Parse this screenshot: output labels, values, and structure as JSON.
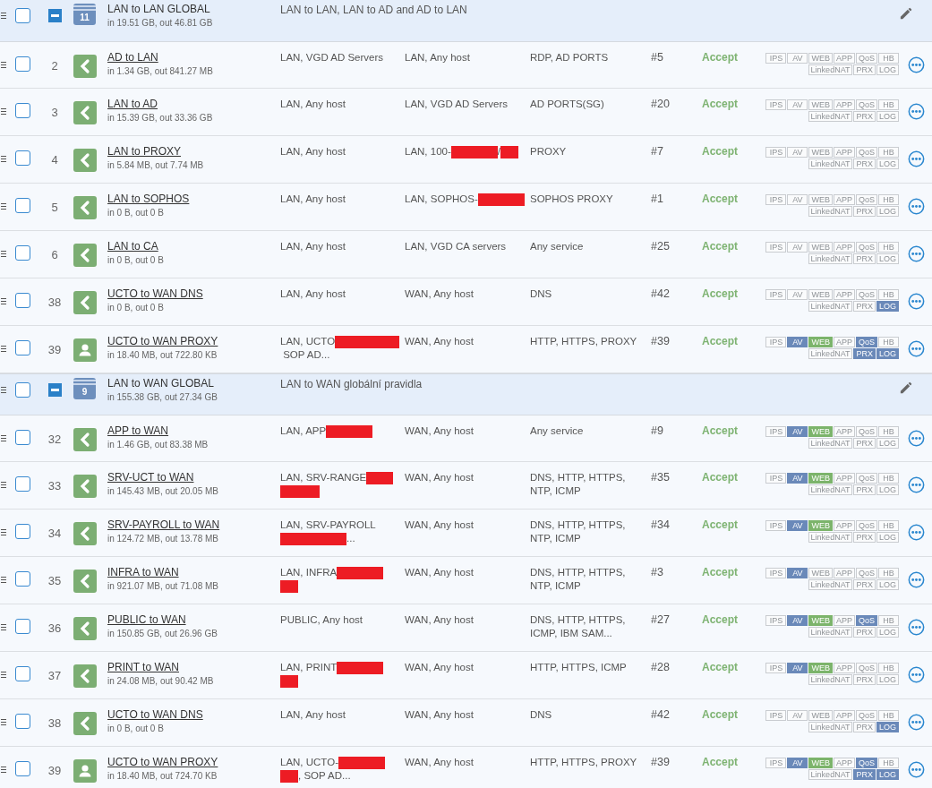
{
  "groups": [
    {
      "checked": false,
      "count": "11",
      "name": "LAN to LAN GLOBAL",
      "stats": "in 19.51 GB, out 46.81 GB",
      "description": "LAN to LAN, LAN to AD and AD to LAN",
      "expanded": true,
      "rules": [
        {
          "checked": false,
          "number": "2",
          "kind": "network",
          "name": "AD to LAN",
          "stats": "in 1.34 GB, out 841.27 MB",
          "source": [
            {
              "kind": "text",
              "text": "LAN, VGD AD Servers"
            }
          ],
          "destination": [
            {
              "kind": "text",
              "text": "LAN, Any host"
            }
          ],
          "service": "RDP, AD PORTS",
          "id": "#5",
          "action": "Accept",
          "flags": [
            {
              "label": "IPS",
              "on": false,
              "kind": "filter"
            },
            {
              "label": "AV",
              "on": false,
              "kind": "filter"
            },
            {
              "label": "WEB",
              "on": false,
              "kind": "web"
            },
            {
              "label": "APP",
              "on": false,
              "kind": "filter"
            },
            {
              "label": "QoS",
              "on": false,
              "kind": "filter"
            },
            {
              "label": "HB",
              "on": false,
              "kind": "filter"
            },
            {
              "label": "LinkedNAT",
              "on": false,
              "kind": "filter"
            },
            {
              "label": "PRX",
              "on": false,
              "kind": "filter"
            },
            {
              "label": "LOG",
              "on": false,
              "kind": "filter"
            }
          ]
        },
        {
          "checked": false,
          "number": "3",
          "kind": "network",
          "name": "LAN to AD",
          "stats": "in 15.39 GB, out 33.36 GB",
          "source": [
            {
              "kind": "text",
              "text": "LAN, Any host"
            }
          ],
          "destination": [
            {
              "kind": "text",
              "text": "LAN, VGD AD Servers"
            }
          ],
          "service": "AD PORTS(SG)",
          "id": "#20",
          "action": "Accept",
          "flags": [
            {
              "label": "IPS",
              "on": false,
              "kind": "filter"
            },
            {
              "label": "AV",
              "on": false,
              "kind": "filter"
            },
            {
              "label": "WEB",
              "on": false,
              "kind": "web"
            },
            {
              "label": "APP",
              "on": false,
              "kind": "filter"
            },
            {
              "label": "QoS",
              "on": false,
              "kind": "filter"
            },
            {
              "label": "HB",
              "on": false,
              "kind": "filter"
            },
            {
              "label": "LinkedNAT",
              "on": false,
              "kind": "filter"
            },
            {
              "label": "PRX",
              "on": false,
              "kind": "filter"
            },
            {
              "label": "LOG",
              "on": false,
              "kind": "filter"
            }
          ]
        },
        {
          "checked": false,
          "number": "4",
          "kind": "network",
          "name": "LAN to PROXY",
          "stats": "in 5.84 MB, out 7.74 MB",
          "source": [
            {
              "kind": "text",
              "text": "LAN, Any host"
            }
          ],
          "destination": [
            {
              "kind": "text",
              "text": "LAN, 100-"
            },
            {
              "kind": "redaction"
            },
            {
              "kind": "text",
              "text": "/"
            },
            {
              "kind": "redaction_short"
            }
          ],
          "service": "PROXY",
          "id": "#7",
          "action": "Accept",
          "flags": [
            {
              "label": "IPS",
              "on": false,
              "kind": "filter"
            },
            {
              "label": "AV",
              "on": false,
              "kind": "filter"
            },
            {
              "label": "WEB",
              "on": false,
              "kind": "web"
            },
            {
              "label": "APP",
              "on": false,
              "kind": "filter"
            },
            {
              "label": "QoS",
              "on": false,
              "kind": "filter"
            },
            {
              "label": "HB",
              "on": false,
              "kind": "filter"
            },
            {
              "label": "LinkedNAT",
              "on": false,
              "kind": "filter"
            },
            {
              "label": "PRX",
              "on": false,
              "kind": "filter"
            },
            {
              "label": "LOG",
              "on": false,
              "kind": "filter"
            }
          ]
        },
        {
          "checked": false,
          "number": "5",
          "kind": "network",
          "name": "LAN to SOPHOS",
          "stats": "in 0 B, out 0 B",
          "source": [
            {
              "kind": "text",
              "text": "LAN, Any host"
            }
          ],
          "destination": [
            {
              "kind": "text",
              "text": "LAN, SOPHOS-"
            },
            {
              "kind": "redaction"
            }
          ],
          "service": "SOPHOS PROXY",
          "id": "#1",
          "action": "Accept",
          "flags": [
            {
              "label": "IPS",
              "on": false,
              "kind": "filter"
            },
            {
              "label": "AV",
              "on": false,
              "kind": "filter"
            },
            {
              "label": "WEB",
              "on": false,
              "kind": "web"
            },
            {
              "label": "APP",
              "on": false,
              "kind": "filter"
            },
            {
              "label": "QoS",
              "on": false,
              "kind": "filter"
            },
            {
              "label": "HB",
              "on": false,
              "kind": "filter"
            },
            {
              "label": "LinkedNAT",
              "on": false,
              "kind": "filter"
            },
            {
              "label": "PRX",
              "on": false,
              "kind": "filter"
            },
            {
              "label": "LOG",
              "on": false,
              "kind": "filter"
            }
          ]
        },
        {
          "checked": false,
          "number": "6",
          "kind": "network",
          "name": "LAN to CA",
          "stats": "in 0 B, out 0 B",
          "source": [
            {
              "kind": "text",
              "text": "LAN, Any host"
            }
          ],
          "destination": [
            {
              "kind": "text",
              "text": "LAN, VGD CA servers"
            }
          ],
          "service": "Any service",
          "id": "#25",
          "action": "Accept",
          "flags": [
            {
              "label": "IPS",
              "on": false,
              "kind": "filter"
            },
            {
              "label": "AV",
              "on": false,
              "kind": "filter"
            },
            {
              "label": "WEB",
              "on": false,
              "kind": "web"
            },
            {
              "label": "APP",
              "on": false,
              "kind": "filter"
            },
            {
              "label": "QoS",
              "on": false,
              "kind": "filter"
            },
            {
              "label": "HB",
              "on": false,
              "kind": "filter"
            },
            {
              "label": "LinkedNAT",
              "on": false,
              "kind": "filter"
            },
            {
              "label": "PRX",
              "on": false,
              "kind": "filter"
            },
            {
              "label": "LOG",
              "on": false,
              "kind": "filter"
            }
          ]
        },
        {
          "checked": false,
          "number": "38",
          "kind": "network",
          "name": "UCTO to WAN DNS",
          "stats": "in 0 B, out 0 B",
          "source": [
            {
              "kind": "text",
              "text": "LAN, Any host"
            }
          ],
          "destination": [
            {
              "kind": "text",
              "text": "WAN, Any host"
            }
          ],
          "service": "DNS",
          "id": "#42",
          "action": "Accept",
          "flags": [
            {
              "label": "IPS",
              "on": false,
              "kind": "filter"
            },
            {
              "label": "AV",
              "on": false,
              "kind": "filter"
            },
            {
              "label": "WEB",
              "on": false,
              "kind": "web"
            },
            {
              "label": "APP",
              "on": false,
              "kind": "filter"
            },
            {
              "label": "QoS",
              "on": false,
              "kind": "filter"
            },
            {
              "label": "HB",
              "on": false,
              "kind": "filter"
            },
            {
              "label": "LinkedNAT",
              "on": false,
              "kind": "filter"
            },
            {
              "label": "PRX",
              "on": false,
              "kind": "filter"
            },
            {
              "label": "LOG",
              "on": true,
              "kind": "filter"
            }
          ]
        },
        {
          "checked": false,
          "number": "39",
          "kind": "user",
          "name": "UCTO to WAN PROXY",
          "stats": "in 18.40 MB, out 722.80 KB",
          "source": [
            {
              "kind": "text",
              "text": "LAN, UCTO"
            },
            {
              "kind": "redaction"
            },
            {
              "kind": "redaction_short"
            },
            {
              "kind": "text",
              "text": " SOP AD..."
            }
          ],
          "destination": [
            {
              "kind": "text",
              "text": "WAN, Any host"
            }
          ],
          "service": "HTTP, HTTPS, PROXY",
          "id": "#39",
          "action": "Accept",
          "flags": [
            {
              "label": "IPS",
              "on": false,
              "kind": "filter"
            },
            {
              "label": "AV",
              "on": true,
              "kind": "filter"
            },
            {
              "label": "WEB",
              "on": true,
              "kind": "web"
            },
            {
              "label": "APP",
              "on": false,
              "kind": "filter"
            },
            {
              "label": "QoS",
              "on": true,
              "kind": "filter"
            },
            {
              "label": "HB",
              "on": false,
              "kind": "filter"
            },
            {
              "label": "LinkedNAT",
              "on": false,
              "kind": "filter"
            },
            {
              "label": "PRX",
              "on": true,
              "kind": "filter"
            },
            {
              "label": "LOG",
              "on": true,
              "kind": "filter"
            }
          ]
        }
      ]
    },
    {
      "checked": false,
      "count": "9",
      "name": "LAN to WAN GLOBAL",
      "stats": "in 155.38 GB, out 27.34 GB",
      "description": "LAN to WAN globální pravidla",
      "expanded": true,
      "rules": [
        {
          "checked": false,
          "number": "32",
          "kind": "network",
          "name": "APP to WAN",
          "stats": "in 1.46 GB, out 83.38 MB",
          "source": [
            {
              "kind": "text",
              "text": "LAN, APP"
            },
            {
              "kind": "redaction"
            }
          ],
          "destination": [
            {
              "kind": "text",
              "text": "WAN, Any host"
            }
          ],
          "service": "Any service",
          "id": "#9",
          "action": "Accept",
          "flags": [
            {
              "label": "IPS",
              "on": false,
              "kind": "filter"
            },
            {
              "label": "AV",
              "on": true,
              "kind": "filter"
            },
            {
              "label": "WEB",
              "on": true,
              "kind": "web"
            },
            {
              "label": "APP",
              "on": false,
              "kind": "filter"
            },
            {
              "label": "QoS",
              "on": false,
              "kind": "filter"
            },
            {
              "label": "HB",
              "on": false,
              "kind": "filter"
            },
            {
              "label": "LinkedNAT",
              "on": false,
              "kind": "filter"
            },
            {
              "label": "PRX",
              "on": false,
              "kind": "filter"
            },
            {
              "label": "LOG",
              "on": false,
              "kind": "filter"
            }
          ]
        },
        {
          "checked": false,
          "number": "33",
          "kind": "network",
          "name": "SRV-UCT to WAN",
          "stats": "in 145.43 MB, out 20.05 MB",
          "source": [
            {
              "kind": "text",
              "text": "LAN, SRV-RANGE"
            },
            {
              "kind": "redaction_mid"
            },
            {
              "kind": "redaction_wide"
            }
          ],
          "destination": [
            {
              "kind": "text",
              "text": "WAN, Any host"
            }
          ],
          "service": "DNS, HTTP, HTTPS, NTP, ICMP",
          "id": "#35",
          "action": "Accept",
          "flags": [
            {
              "label": "IPS",
              "on": false,
              "kind": "filter"
            },
            {
              "label": "AV",
              "on": true,
              "kind": "filter"
            },
            {
              "label": "WEB",
              "on": true,
              "kind": "web"
            },
            {
              "label": "APP",
              "on": false,
              "kind": "filter"
            },
            {
              "label": "QoS",
              "on": false,
              "kind": "filter"
            },
            {
              "label": "HB",
              "on": false,
              "kind": "filter"
            },
            {
              "label": "LinkedNAT",
              "on": false,
              "kind": "filter"
            },
            {
              "label": "PRX",
              "on": false,
              "kind": "filter"
            },
            {
              "label": "LOG",
              "on": false,
              "kind": "filter"
            }
          ]
        },
        {
          "checked": false,
          "number": "34",
          "kind": "network",
          "name": "SRV-PAYROLL to WAN",
          "stats": "in 124.72 MB, out 13.78 MB",
          "source": [
            {
              "kind": "text",
              "text": "LAN, SRV-PAYROLL"
            },
            {
              "kind": "redaction_mid"
            },
            {
              "kind": "redaction_wide"
            },
            {
              "kind": "text",
              "text": "..."
            }
          ],
          "destination": [
            {
              "kind": "text",
              "text": "WAN, Any host"
            }
          ],
          "service": "DNS, HTTP, HTTPS, NTP, ICMP",
          "id": "#34",
          "action": "Accept",
          "flags": [
            {
              "label": "IPS",
              "on": false,
              "kind": "filter"
            },
            {
              "label": "AV",
              "on": true,
              "kind": "filter"
            },
            {
              "label": "WEB",
              "on": true,
              "kind": "web"
            },
            {
              "label": "APP",
              "on": false,
              "kind": "filter"
            },
            {
              "label": "QoS",
              "on": false,
              "kind": "filter"
            },
            {
              "label": "HB",
              "on": false,
              "kind": "filter"
            },
            {
              "label": "LinkedNAT",
              "on": false,
              "kind": "filter"
            },
            {
              "label": "PRX",
              "on": false,
              "kind": "filter"
            },
            {
              "label": "LOG",
              "on": false,
              "kind": "filter"
            }
          ]
        },
        {
          "checked": false,
          "number": "35",
          "kind": "network",
          "name": "INFRA to WAN",
          "stats": "in 921.07 MB, out 71.08 MB",
          "source": [
            {
              "kind": "text",
              "text": "LAN, INFRA"
            },
            {
              "kind": "redaction"
            },
            {
              "kind": "redaction_short"
            }
          ],
          "destination": [
            {
              "kind": "text",
              "text": "WAN, Any host"
            }
          ],
          "service": "DNS, HTTP, HTTPS, NTP, ICMP",
          "id": "#3",
          "action": "Accept",
          "flags": [
            {
              "label": "IPS",
              "on": false,
              "kind": "filter"
            },
            {
              "label": "AV",
              "on": true,
              "kind": "filter"
            },
            {
              "label": "WEB",
              "on": false,
              "kind": "web"
            },
            {
              "label": "APP",
              "on": false,
              "kind": "filter"
            },
            {
              "label": "QoS",
              "on": false,
              "kind": "filter"
            },
            {
              "label": "HB",
              "on": false,
              "kind": "filter"
            },
            {
              "label": "LinkedNAT",
              "on": false,
              "kind": "filter"
            },
            {
              "label": "PRX",
              "on": false,
              "kind": "filter"
            },
            {
              "label": "LOG",
              "on": false,
              "kind": "filter"
            }
          ]
        },
        {
          "checked": false,
          "number": "36",
          "kind": "network",
          "name": "PUBLIC to WAN",
          "stats": "in 150.85 GB, out 26.96 GB",
          "source": [
            {
              "kind": "text",
              "text": "PUBLIC, Any host"
            }
          ],
          "destination": [
            {
              "kind": "text",
              "text": "WAN, Any host"
            }
          ],
          "service": "DNS, HTTP, HTTPS, ICMP, IBM SAM...",
          "id": "#27",
          "action": "Accept",
          "flags": [
            {
              "label": "IPS",
              "on": false,
              "kind": "filter"
            },
            {
              "label": "AV",
              "on": true,
              "kind": "filter"
            },
            {
              "label": "WEB",
              "on": true,
              "kind": "web"
            },
            {
              "label": "APP",
              "on": false,
              "kind": "filter"
            },
            {
              "label": "QoS",
              "on": true,
              "kind": "filter"
            },
            {
              "label": "HB",
              "on": false,
              "kind": "filter"
            },
            {
              "label": "LinkedNAT",
              "on": false,
              "kind": "filter"
            },
            {
              "label": "PRX",
              "on": false,
              "kind": "filter"
            },
            {
              "label": "LOG",
              "on": false,
              "kind": "filter"
            }
          ]
        },
        {
          "checked": false,
          "number": "37",
          "kind": "network",
          "name": "PRINT to WAN",
          "stats": "in 24.08 MB, out 90.42 MB",
          "source": [
            {
              "kind": "text",
              "text": "LAN, PRINT"
            },
            {
              "kind": "redaction"
            },
            {
              "kind": "redaction_short"
            }
          ],
          "destination": [
            {
              "kind": "text",
              "text": "WAN, Any host"
            }
          ],
          "service": "HTTP, HTTPS, ICMP",
          "id": "#28",
          "action": "Accept",
          "flags": [
            {
              "label": "IPS",
              "on": false,
              "kind": "filter"
            },
            {
              "label": "AV",
              "on": true,
              "kind": "filter"
            },
            {
              "label": "WEB",
              "on": true,
              "kind": "web"
            },
            {
              "label": "APP",
              "on": false,
              "kind": "filter"
            },
            {
              "label": "QoS",
              "on": false,
              "kind": "filter"
            },
            {
              "label": "HB",
              "on": false,
              "kind": "filter"
            },
            {
              "label": "LinkedNAT",
              "on": false,
              "kind": "filter"
            },
            {
              "label": "PRX",
              "on": false,
              "kind": "filter"
            },
            {
              "label": "LOG",
              "on": false,
              "kind": "filter"
            }
          ]
        },
        {
          "checked": false,
          "number": "38",
          "kind": "network",
          "name": "UCTO to WAN DNS",
          "stats": "in 0 B, out 0 B",
          "source": [
            {
              "kind": "text",
              "text": "LAN, Any host"
            }
          ],
          "destination": [
            {
              "kind": "text",
              "text": "WAN, Any host"
            }
          ],
          "service": "DNS",
          "id": "#42",
          "action": "Accept",
          "flags": [
            {
              "label": "IPS",
              "on": false,
              "kind": "filter"
            },
            {
              "label": "AV",
              "on": false,
              "kind": "filter"
            },
            {
              "label": "WEB",
              "on": false,
              "kind": "web"
            },
            {
              "label": "APP",
              "on": false,
              "kind": "filter"
            },
            {
              "label": "QoS",
              "on": false,
              "kind": "filter"
            },
            {
              "label": "HB",
              "on": false,
              "kind": "filter"
            },
            {
              "label": "LinkedNAT",
              "on": false,
              "kind": "filter"
            },
            {
              "label": "PRX",
              "on": false,
              "kind": "filter"
            },
            {
              "label": "LOG",
              "on": true,
              "kind": "filter"
            }
          ]
        },
        {
          "checked": false,
          "number": "39",
          "kind": "user",
          "name": "UCTO to WAN PROXY",
          "stats": "in 18.40 MB, out 724.70 KB",
          "source": [
            {
              "kind": "text",
              "text": "LAN, UCTO-"
            },
            {
              "kind": "redaction"
            },
            {
              "kind": "redaction_short"
            },
            {
              "kind": "text",
              "text": ", SOP AD..."
            }
          ],
          "destination": [
            {
              "kind": "text",
              "text": "WAN, Any host"
            }
          ],
          "service": "HTTP, HTTPS, PROXY",
          "id": "#39",
          "action": "Accept",
          "flags": [
            {
              "label": "IPS",
              "on": false,
              "kind": "filter"
            },
            {
              "label": "AV",
              "on": true,
              "kind": "filter"
            },
            {
              "label": "WEB",
              "on": true,
              "kind": "web"
            },
            {
              "label": "APP",
              "on": false,
              "kind": "filter"
            },
            {
              "label": "QoS",
              "on": true,
              "kind": "filter"
            },
            {
              "label": "HB",
              "on": false,
              "kind": "filter"
            },
            {
              "label": "LinkedNAT",
              "on": false,
              "kind": "filter"
            },
            {
              "label": "PRX",
              "on": true,
              "kind": "filter"
            },
            {
              "label": "LOG",
              "on": true,
              "kind": "filter"
            }
          ]
        }
      ]
    }
  ]
}
